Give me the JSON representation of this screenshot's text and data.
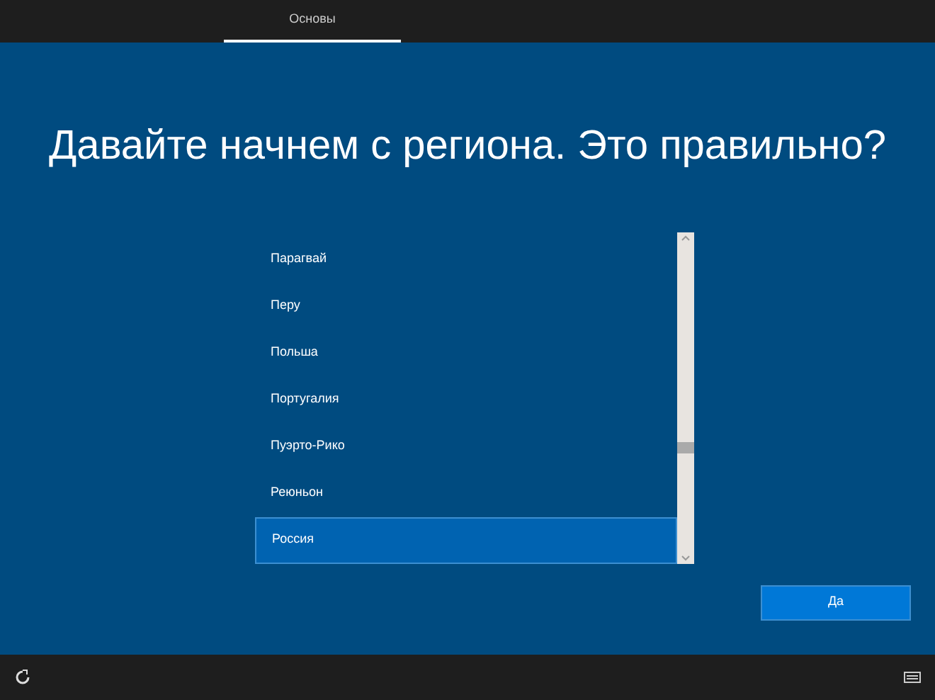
{
  "tabs": [
    {
      "label": "Основы",
      "selected": true
    }
  ],
  "title": "Давайте начнем с региона. Это правильно?",
  "regions": [
    {
      "label": "Парагвай",
      "selected": false
    },
    {
      "label": "Перу",
      "selected": false
    },
    {
      "label": "Польша",
      "selected": false
    },
    {
      "label": "Португалия",
      "selected": false
    },
    {
      "label": "Пуэрто-Рико",
      "selected": false
    },
    {
      "label": "Реюньон",
      "selected": false
    },
    {
      "label": "Россия",
      "selected": true
    }
  ],
  "confirm_button": "Да"
}
